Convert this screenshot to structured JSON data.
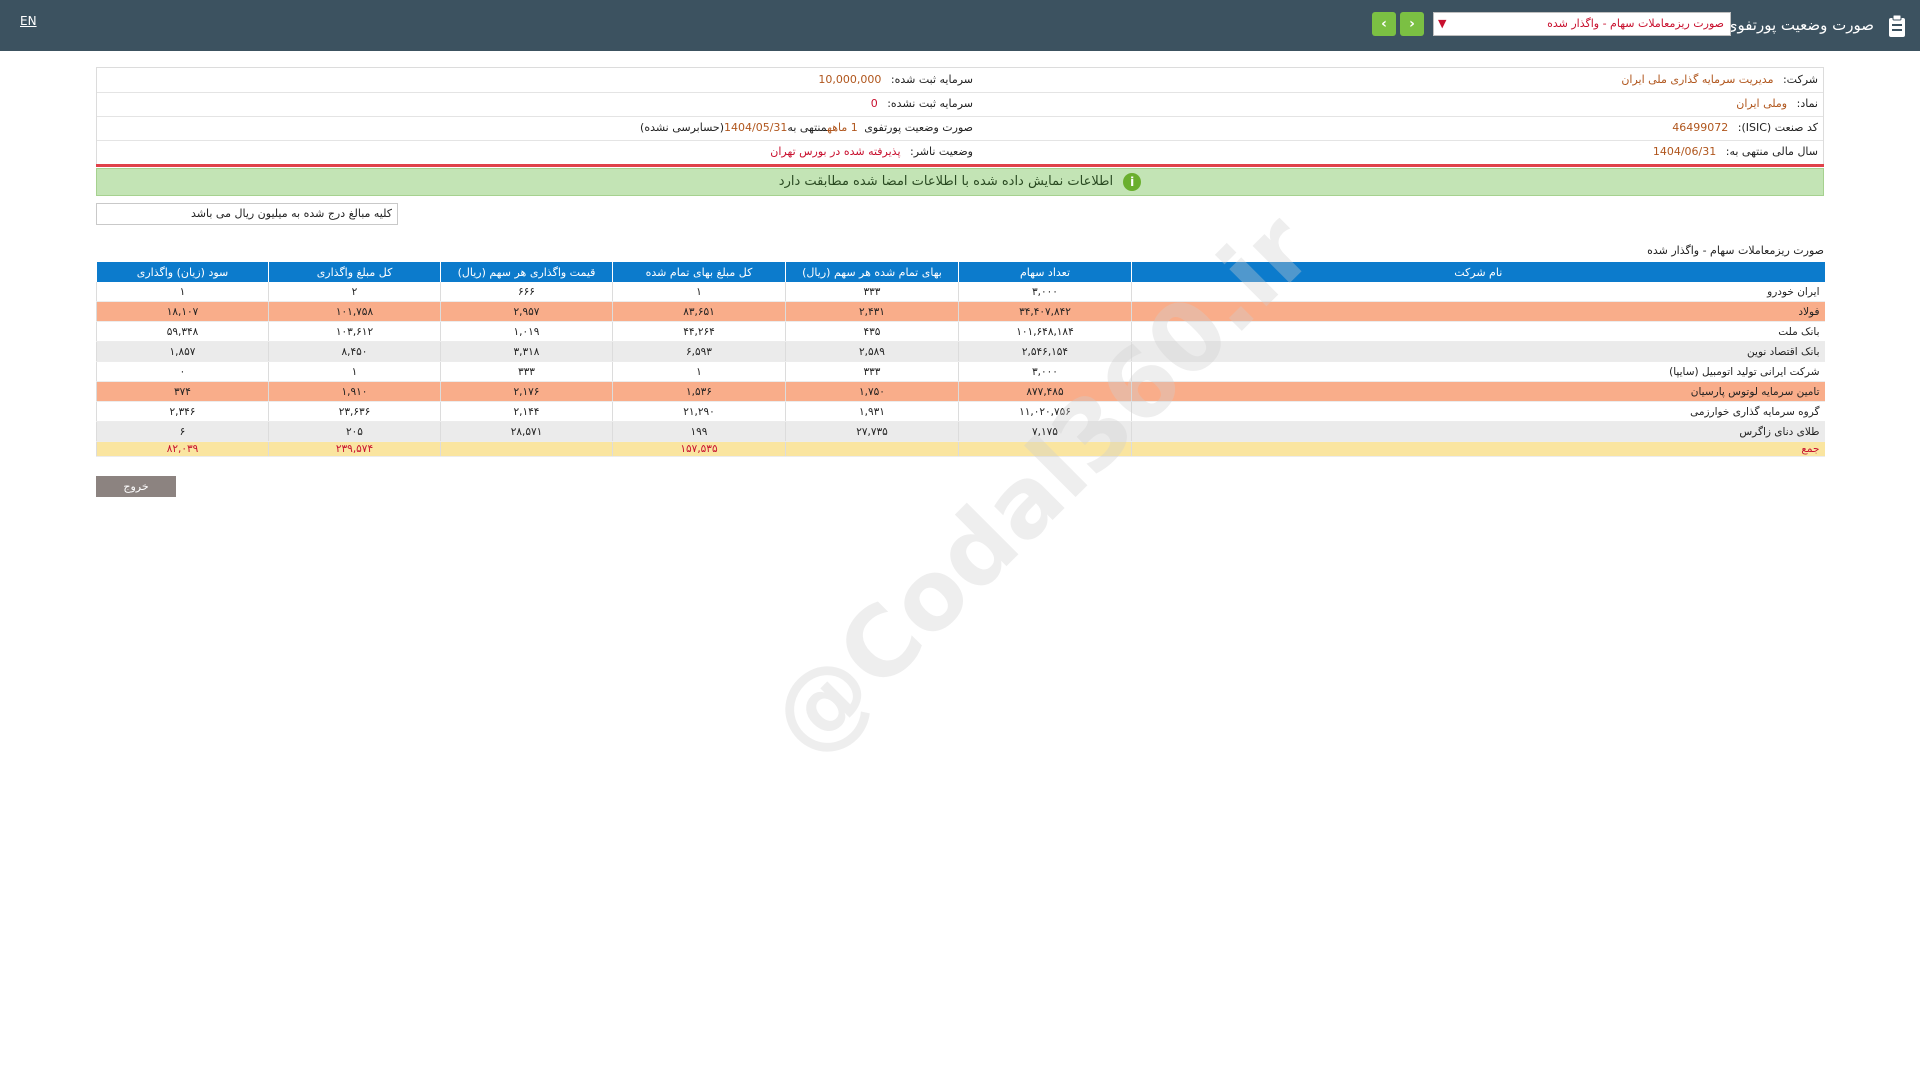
{
  "topbar": {
    "lang": "EN",
    "title": "صورت وضعیت پورتفوی",
    "selected_report": "صورت ریزمعاملات سهام - واگذار شده",
    "icon": "clipboard-icon",
    "next_icon": "chevron-right-icon",
    "prev_icon": "chevron-left-icon",
    "accent": "#7bc043"
  },
  "info": {
    "company_label": "شرکت:",
    "company_value": "مدیریت سرمایه گذاری ملی ایران",
    "capital_reg_label": "سرمایه ثبت شده:",
    "capital_reg_value": "10,000,000",
    "symbol_label": "نماد:",
    "symbol_value": "وملی ایران",
    "capital_unreg_label": "سرمایه ثبت نشده:",
    "capital_unreg_value": "0",
    "isic_label": "کد صنعت (ISIC):",
    "isic_value": "46499072",
    "report_label": "صورت وضعیت پورتفوی",
    "report_period": "1 ماهه",
    "report_end_label": "منتهی به",
    "report_end_date": "1404/05/31",
    "report_audit": "(حسابرسی نشده)",
    "fiscal_label": "سال مالی منتهی به:",
    "fiscal_value": "1404/06/31",
    "publisher_label": "وضعیت ناشر:",
    "publisher_value": "پذیرفته شده در بورس تهران"
  },
  "alert": {
    "message": "اطلاعات نمایش داده شده با اطلاعات امضا شده مطابقت دارد",
    "icon": "info-icon"
  },
  "units_note": "کلیه مبالغ درج شده به میلیون ریال می باشد",
  "section_title": "صورت ریزمعاملات سهام - واگذار شده",
  "table": {
    "headers": [
      "نام شرکت",
      "تعداد سهام",
      "بهای تمام شده هر سهم (ریال)",
      "کل مبلغ بهای تمام شده",
      "قیمت واگذاری هر سهم (ریال)",
      "کل مبلغ واگذاری",
      "سود (زیان) واگذاری"
    ],
    "rows": [
      {
        "style": "white",
        "cells": [
          "ایران خودرو",
          "۳,۰۰۰",
          "۳۳۳",
          "۱",
          "۶۶۶",
          "۲",
          "۱"
        ]
      },
      {
        "style": "orange",
        "cells": [
          "فولاد",
          "۳۴,۴۰۷,۸۴۲",
          "۲,۴۳۱",
          "۸۳,۶۵۱",
          "۲,۹۵۷",
          "۱۰۱,۷۵۸",
          "۱۸,۱۰۷"
        ]
      },
      {
        "style": "white",
        "cells": [
          "بانک ملت",
          "۱۰۱,۶۴۸,۱۸۴",
          "۴۳۵",
          "۴۴,۲۶۴",
          "۱,۰۱۹",
          "۱۰۳,۶۱۲",
          "۵۹,۳۴۸"
        ]
      },
      {
        "style": "gray",
        "cells": [
          "بانک اقتصاد نوین",
          "۲,۵۴۶,۱۵۴",
          "۲,۵۸۹",
          "۶,۵۹۳",
          "۳,۳۱۸",
          "۸,۴۵۰",
          "۱,۸۵۷"
        ]
      },
      {
        "style": "white",
        "cells": [
          "شرکت ایرانی تولید اتومبیل (سایپا)",
          "۳,۰۰۰",
          "۳۳۳",
          "۱",
          "۳۳۳",
          "۱",
          "۰"
        ]
      },
      {
        "style": "orange",
        "cells": [
          "تامین سرمایه لوتوس پارسیان",
          "۸۷۷,۴۸۵",
          "۱,۷۵۰",
          "۱,۵۳۶",
          "۲,۱۷۶",
          "۱,۹۱۰",
          "۳۷۴"
        ]
      },
      {
        "style": "white",
        "cells": [
          "گروه سرمایه گذاری خوارزمی",
          "۱۱,۰۲۰,۷۵۶",
          "۱,۹۳۱",
          "۲۱,۲۹۰",
          "۲,۱۴۴",
          "۲۳,۶۳۶",
          "۲,۳۴۶"
        ]
      },
      {
        "style": "gray",
        "cells": [
          "طلای دنای زاگرس",
          "۷,۱۷۵",
          "۲۷,۷۳۵",
          "۱۹۹",
          "۲۸,۵۷۱",
          "۲۰۵",
          "۶"
        ]
      },
      {
        "style": "total",
        "cells": [
          "جمع",
          "",
          "",
          "۱۵۷,۵۳۵",
          "",
          "۲۳۹,۵۷۴",
          "۸۲,۰۳۹"
        ]
      }
    ]
  },
  "exit_button": "خروج",
  "watermark": "@Codal360.ir"
}
